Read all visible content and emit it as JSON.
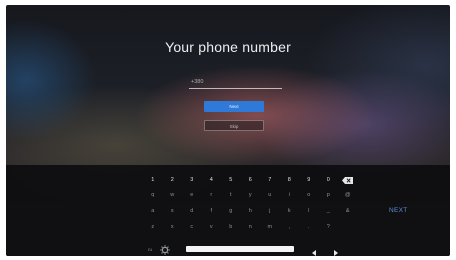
{
  "title": "Your phone number",
  "phone_input": {
    "placeholder": "+380",
    "value": ""
  },
  "buttons": {
    "primary": "Next",
    "secondary": "Skip"
  },
  "keyboard": {
    "row1": [
      "1",
      "2",
      "3",
      "4",
      "5",
      "6",
      "7",
      "8",
      "9",
      "0"
    ],
    "row2": [
      "q",
      "w",
      "e",
      "r",
      "t",
      "y",
      "u",
      "i",
      "o",
      "p",
      "@"
    ],
    "row3": [
      "a",
      "s",
      "d",
      "f",
      "g",
      "h",
      "j",
      "k",
      "l",
      "_",
      "&"
    ],
    "row4": [
      "z",
      "x",
      "c",
      "v",
      "b",
      "n",
      "m",
      ",",
      ".",
      "?"
    ],
    "lang_key": "ru",
    "next_label": "NEXT",
    "icons": {
      "backspace": "backspace-icon",
      "settings": "gear-icon",
      "left": "arrow-left-icon",
      "right": "arrow-right-icon"
    }
  },
  "colors": {
    "accent": "#2f79d8",
    "next_text": "#5b8fd8"
  }
}
